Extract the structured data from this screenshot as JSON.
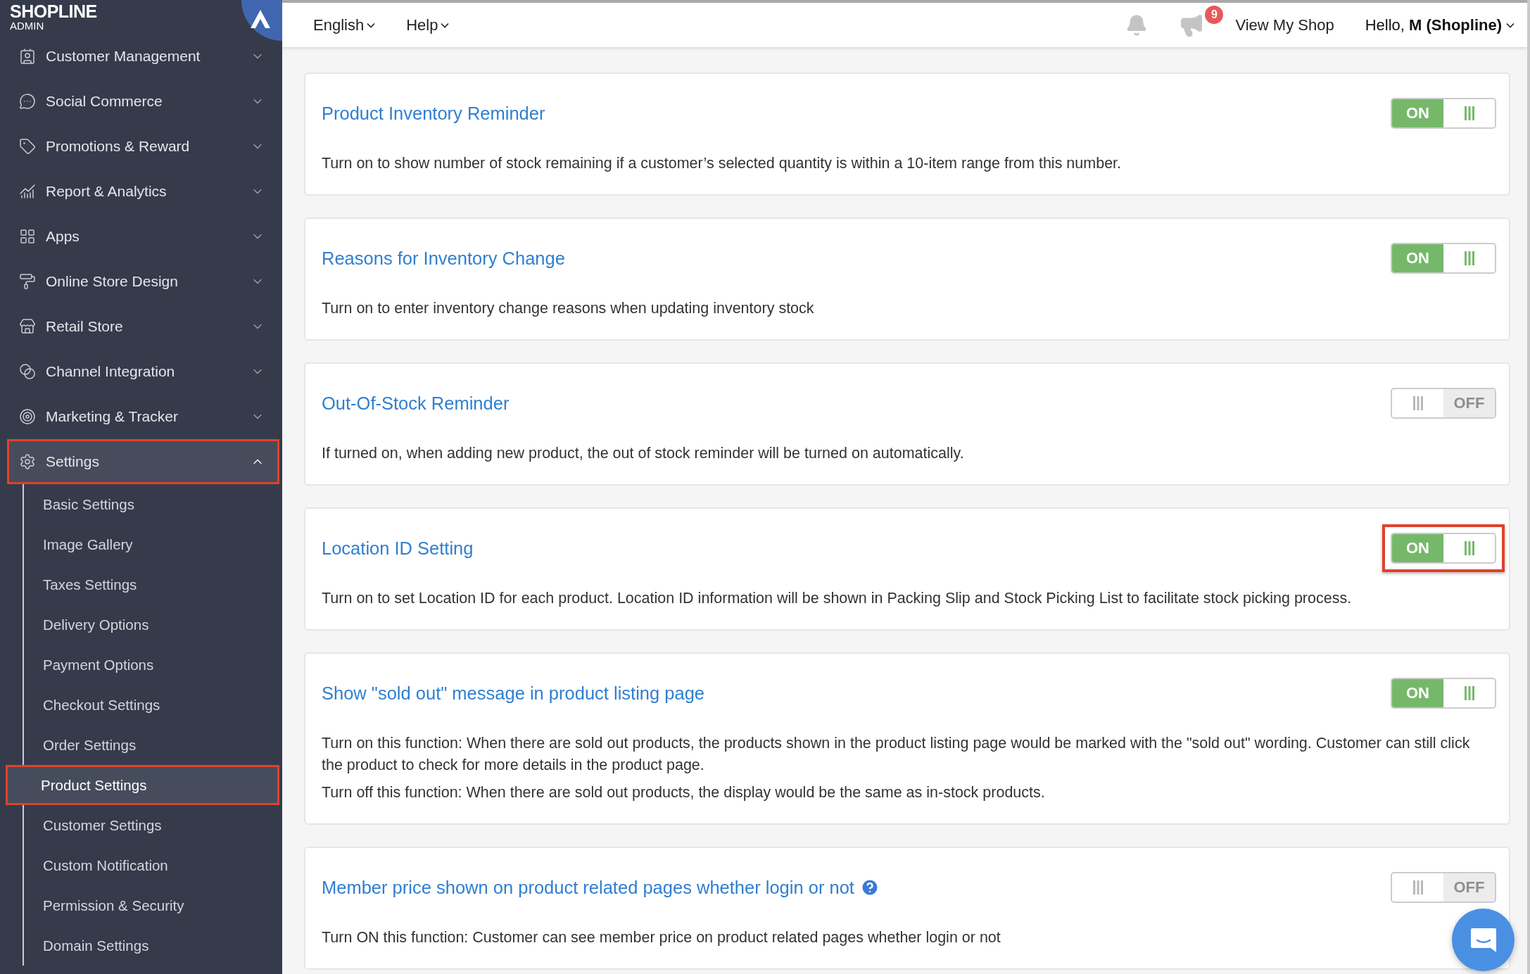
{
  "sidebar": {
    "logo": {
      "brand": "SHOPLINE",
      "sub": "ADMIN"
    },
    "items": [
      {
        "label": "Customer Management",
        "expanded": false,
        "selected": false,
        "highlighted": false
      },
      {
        "label": "Social Commerce",
        "expanded": false,
        "selected": false,
        "highlighted": false
      },
      {
        "label": "Promotions & Reward",
        "expanded": false,
        "selected": false,
        "highlighted": false
      },
      {
        "label": "Report & Analytics",
        "expanded": false,
        "selected": false,
        "highlighted": false
      },
      {
        "label": "Apps",
        "expanded": false,
        "selected": false,
        "highlighted": false
      },
      {
        "label": "Online Store Design",
        "expanded": false,
        "selected": false,
        "highlighted": false
      },
      {
        "label": "Retail Store",
        "expanded": false,
        "selected": false,
        "highlighted": false
      },
      {
        "label": "Channel Integration",
        "expanded": false,
        "selected": false,
        "highlighted": false
      },
      {
        "label": "Marketing & Tracker",
        "expanded": false,
        "selected": false,
        "highlighted": false
      },
      {
        "label": "Settings",
        "expanded": true,
        "selected": true,
        "highlighted": true,
        "children": [
          {
            "label": "Basic Settings",
            "selected": false,
            "highlighted": false
          },
          {
            "label": "Image Gallery",
            "selected": false,
            "highlighted": false
          },
          {
            "label": "Taxes Settings",
            "selected": false,
            "highlighted": false
          },
          {
            "label": "Delivery Options",
            "selected": false,
            "highlighted": false
          },
          {
            "label": "Payment Options",
            "selected": false,
            "highlighted": false
          },
          {
            "label": "Checkout Settings",
            "selected": false,
            "highlighted": false
          },
          {
            "label": "Order Settings",
            "selected": false,
            "highlighted": false
          },
          {
            "label": "Product Settings",
            "selected": true,
            "highlighted": true
          },
          {
            "label": "Customer Settings",
            "selected": false,
            "highlighted": false
          },
          {
            "label": "Custom Notification",
            "selected": false,
            "highlighted": false
          },
          {
            "label": "Permission & Security",
            "selected": false,
            "highlighted": false
          },
          {
            "label": "Domain Settings",
            "selected": false,
            "highlighted": false
          }
        ]
      }
    ]
  },
  "topbar": {
    "menus": [
      {
        "label": "English"
      },
      {
        "label": "Help"
      }
    ],
    "notification_badge": "9",
    "view_shop": "View My Shop",
    "greeting": "Hello, **M (Shopline)**"
  },
  "settings": [
    {
      "title": "Product Inventory Reminder",
      "help": false,
      "on": true,
      "toggle_label": "ON",
      "highlighted": false,
      "description": [
        "Turn on to show number of stock remaining if a customer’s selected quantity is within a 10-item range from this number."
      ]
    },
    {
      "title": "Reasons for Inventory Change",
      "help": false,
      "on": true,
      "toggle_label": "ON",
      "highlighted": false,
      "description": [
        "Turn on to enter inventory change reasons when updating inventory stock"
      ]
    },
    {
      "title": "Out-Of-Stock Reminder",
      "help": false,
      "on": false,
      "toggle_label": "OFF",
      "highlighted": false,
      "description": [
        "If turned on, when adding new product, the out of stock reminder will be turned on automatically."
      ]
    },
    {
      "title": "Location ID Setting",
      "help": false,
      "on": true,
      "toggle_label": "ON",
      "highlighted": true,
      "description": [
        "Turn on to set Location ID for each product. Location ID information will be shown in Packing Slip and Stock Picking List to facilitate stock picking process."
      ]
    },
    {
      "title": "Show \"sold out\" message in product listing page",
      "help": false,
      "on": true,
      "toggle_label": "ON",
      "highlighted": false,
      "description": [
        "Turn on this function: When there are sold out products, the products shown in the product listing page would be marked with the \"sold out\" wording. Customer can still click the product to check for more details in the product page.",
        "Turn off this function: When there are sold out products, the display would be the same as in-stock products."
      ]
    },
    {
      "title": "Member price shown on product related pages whether login or not",
      "help": true,
      "on": false,
      "toggle_label": "OFF",
      "highlighted": false,
      "description": [
        "Turn ON this function: Customer can see member price on product related pages whether login or not"
      ]
    }
  ]
}
